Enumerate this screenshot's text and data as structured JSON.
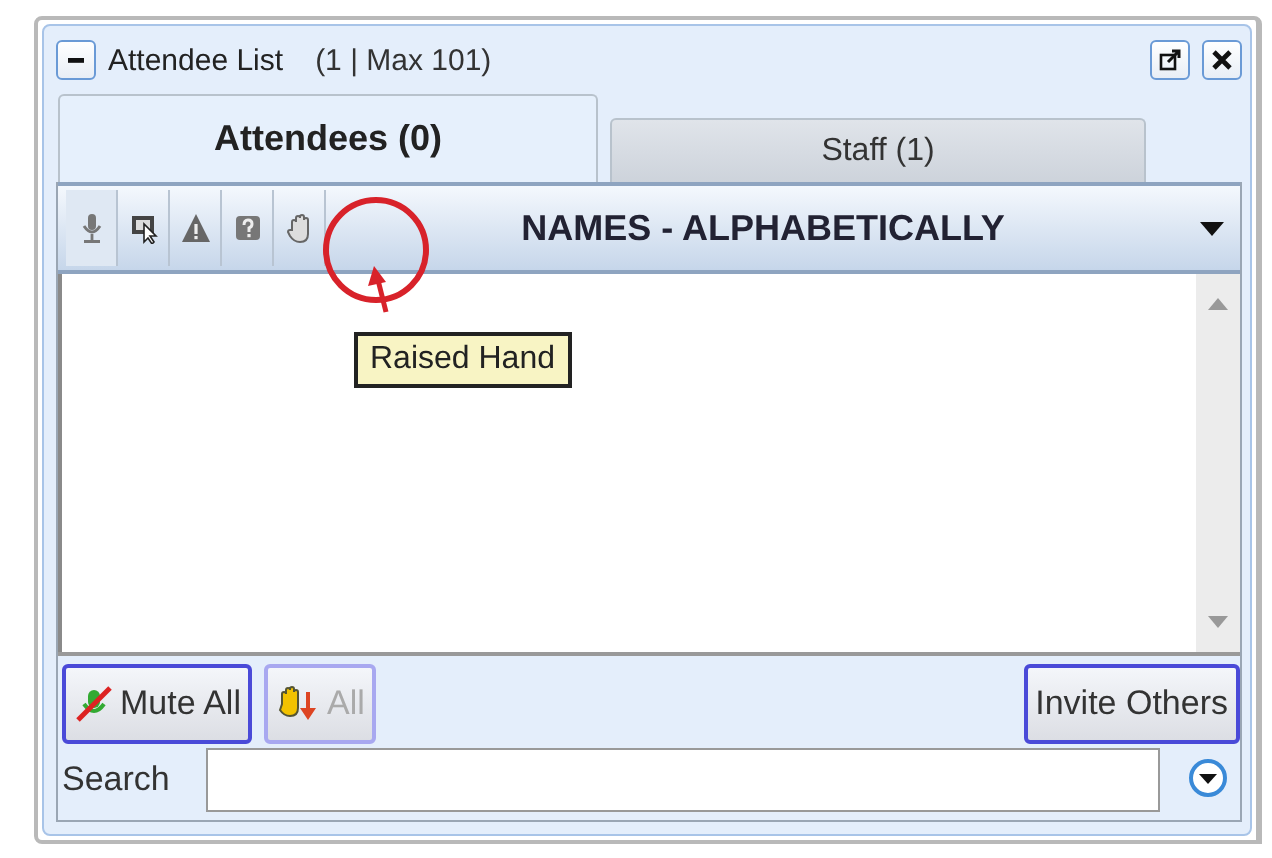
{
  "window": {
    "title": "Attendee List",
    "count": "(1 | Max 101)"
  },
  "tabs": [
    {
      "label": "Attendees (0)",
      "selected": true
    },
    {
      "label": "Staff (1)",
      "selected": false
    }
  ],
  "columns": {
    "icons": [
      {
        "kind": "microphone",
        "selected": true
      },
      {
        "kind": "screen",
        "selected": false
      },
      {
        "kind": "warning",
        "selected": false
      },
      {
        "kind": "question",
        "selected": false
      },
      {
        "kind": "hand",
        "selected": false
      }
    ],
    "sort": "NAMES - ALPHABETICALLY"
  },
  "tooltip": "Raised Hand",
  "buttons": [
    {
      "kind": "mute",
      "label": "Mute All",
      "disabled": false
    },
    {
      "kind": "lower-hands",
      "label": "All",
      "disabled": true
    },
    {
      "kind": "plain",
      "label": "Invite Others",
      "disabled": false
    }
  ],
  "search": {
    "label": "Search"
  }
}
